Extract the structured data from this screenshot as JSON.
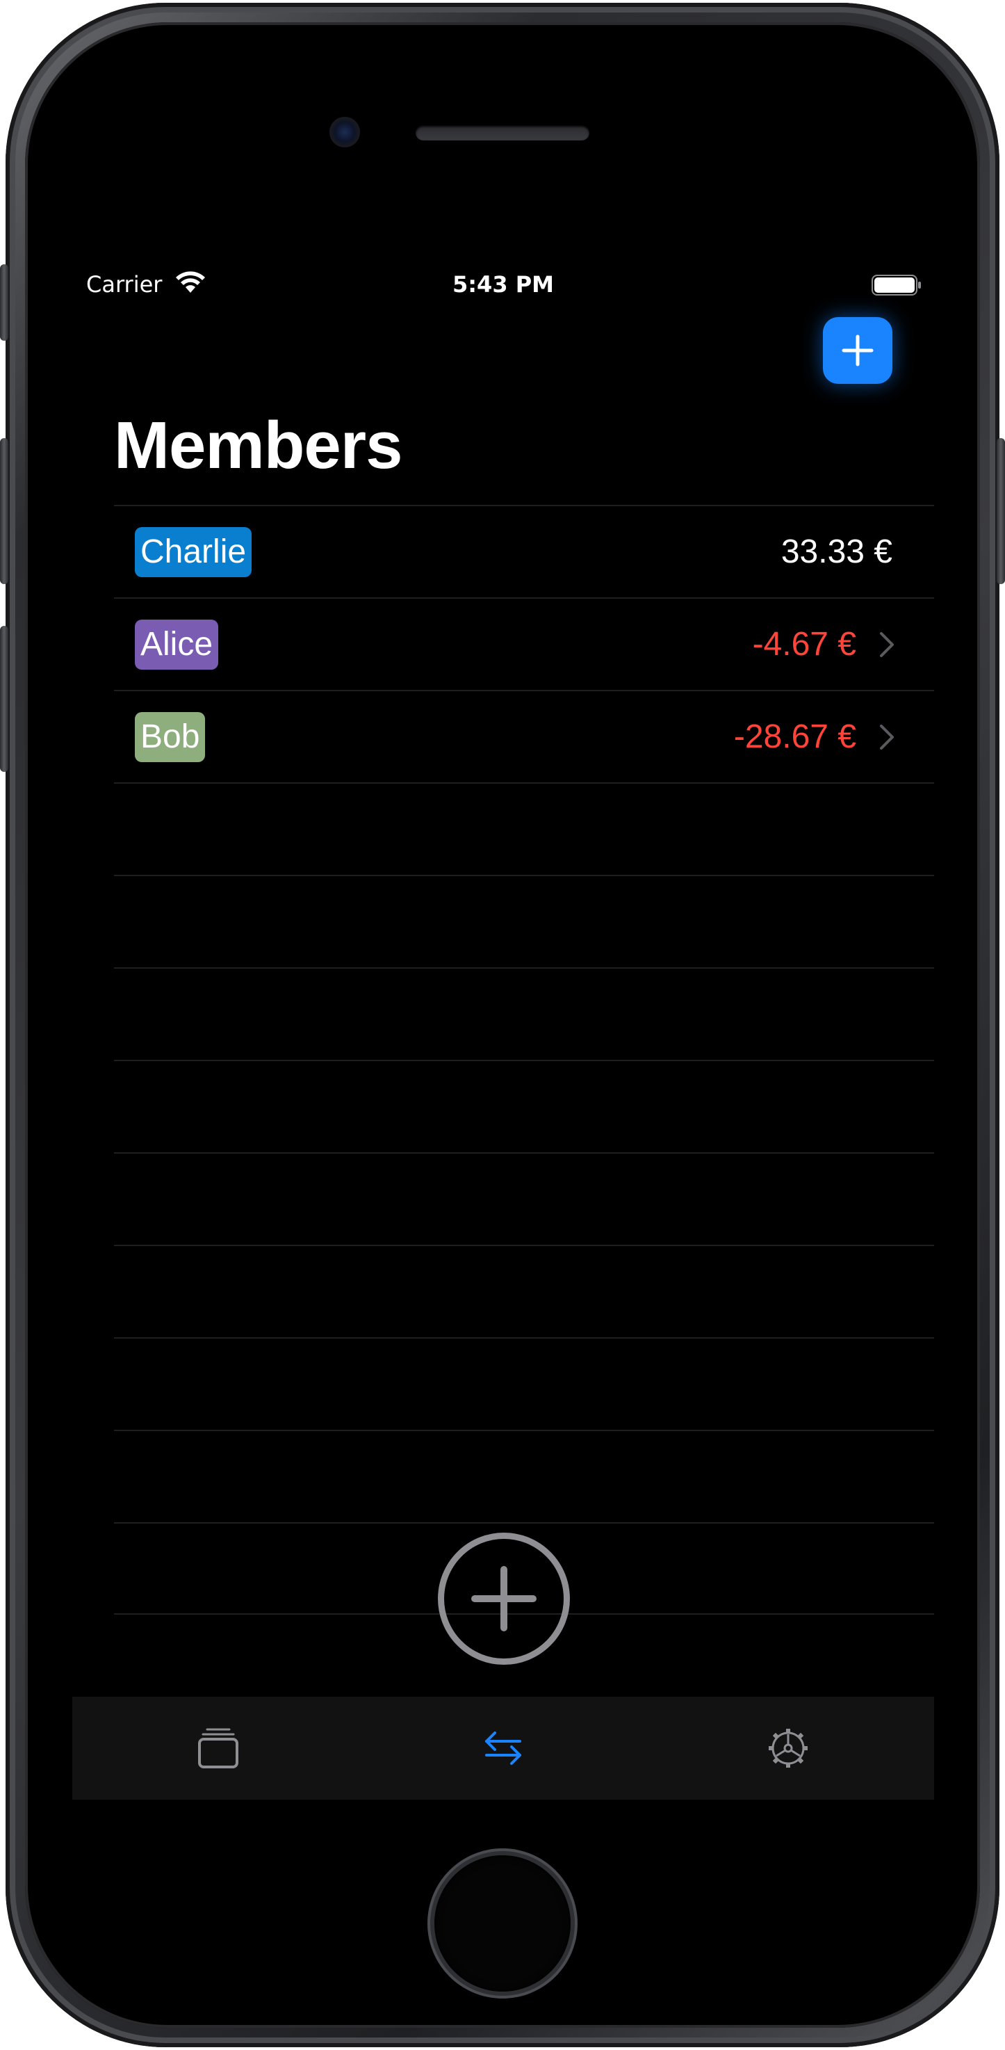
{
  "status_bar": {
    "carrier": "Carrier",
    "time": "5:43 PM"
  },
  "header": {
    "title": "Members",
    "add_icon": "plus-icon"
  },
  "members": [
    {
      "name": "Charlie",
      "amount": "33.33 €",
      "badge_color": "#0a7fd0",
      "amount_color": "#ffffff",
      "has_chevron": false
    },
    {
      "name": "Alice",
      "amount": "-4.67 €",
      "badge_color": "#7b5cb3",
      "amount_color": "#ff453a",
      "has_chevron": true
    },
    {
      "name": "Bob",
      "amount": "-28.67 €",
      "badge_color": "#8fae7d",
      "amount_color": "#ff453a",
      "has_chevron": true
    }
  ],
  "tab_bar": {
    "tabs": [
      {
        "icon": "stack-icon",
        "selected": false
      },
      {
        "icon": "transfer-arrows-icon",
        "selected": true
      },
      {
        "icon": "settings-gear-icon",
        "selected": false
      }
    ]
  },
  "colors": {
    "accent": "#1a84ff",
    "negative": "#ff453a",
    "inactive": "#8e8e93"
  }
}
